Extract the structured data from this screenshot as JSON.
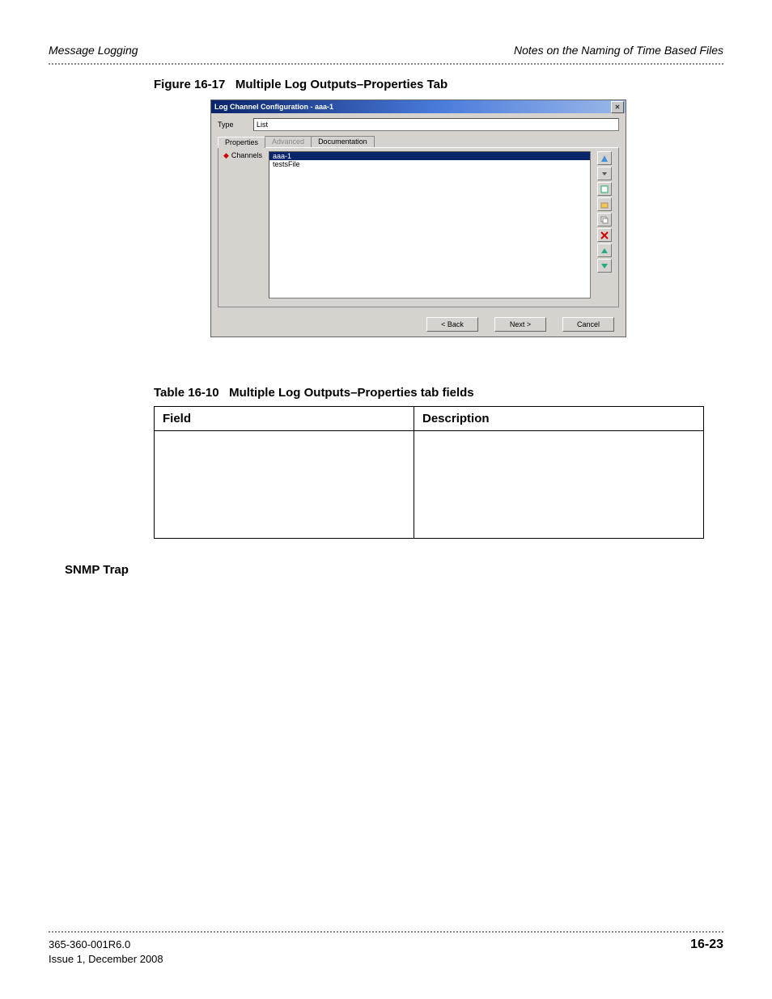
{
  "header": {
    "left": "Message Logging",
    "right": "Notes on the Naming of Time Based Files"
  },
  "figure": {
    "caption_no": "Figure 16-17",
    "caption_text": "Multiple Log Outputs–Properties Tab"
  },
  "dialog": {
    "title": "Log Channel Configuration - aaa-1",
    "type_label": "Type",
    "type_value": "List",
    "tabs": {
      "properties": "Properties",
      "advanced": "Advanced",
      "documentation": "Documentation"
    },
    "channels_label": "Channels",
    "list_items": [
      "aaa-1",
      "testsFile"
    ],
    "buttons": {
      "back": "< Back",
      "next": "Next >",
      "cancel": "Cancel"
    }
  },
  "table": {
    "caption_no": "Table 16-10",
    "caption_text": "Multiple Log Outputs–Properties tab fields",
    "col1": "Field",
    "col2": "Description"
  },
  "section": "SNMP Trap",
  "footer": {
    "docno": "365-360-001R6.0",
    "issue": "Issue 1,   December 2008",
    "page": "16-23"
  }
}
